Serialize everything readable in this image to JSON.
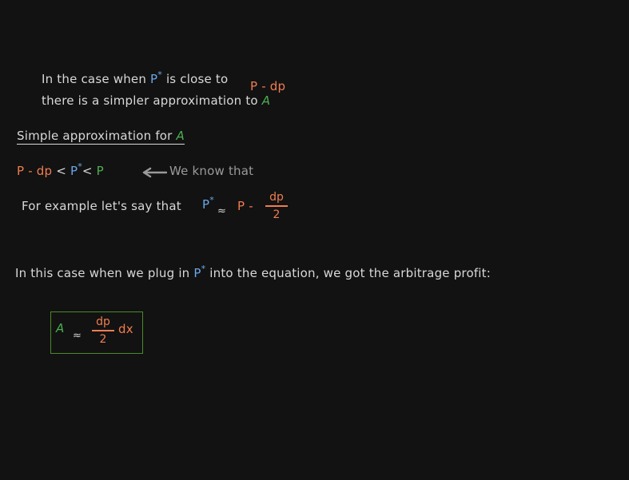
{
  "intro": {
    "line1_prefix": "In the case when",
    "p_star": "P*",
    "line1_mid": "is close to",
    "p_minus_dp": "P - dp",
    "line2_prefix": "there is a simpler approximation to",
    "A": "A"
  },
  "section_title": {
    "prefix": "Simple approximation for",
    "A": "A"
  },
  "inequality": {
    "left": "P - dp",
    "lt1": "<",
    "middle": "P*",
    "lt2": "<",
    "right": "P",
    "note": "We know that"
  },
  "example": {
    "text": "For example let's say that",
    "p_star": "P*",
    "approx": "≈",
    "p_minus": "P -",
    "num": "dp",
    "den": "2"
  },
  "plug": {
    "prefix": "In this case when we plug in",
    "p_star": "P*",
    "suffix": "into the equation, we got the arbitrage profit:"
  },
  "result": {
    "A": "A",
    "approx": "≈",
    "num": "dp",
    "den": "2",
    "dx": "dx"
  },
  "colors": {
    "background": "#121212",
    "text": "#d8d8d8",
    "orange": "#f07d50",
    "blue": "#6aa8e8",
    "green": "#4caf50",
    "gray": "#9a9a9a",
    "box_border": "#4a8a2a"
  }
}
